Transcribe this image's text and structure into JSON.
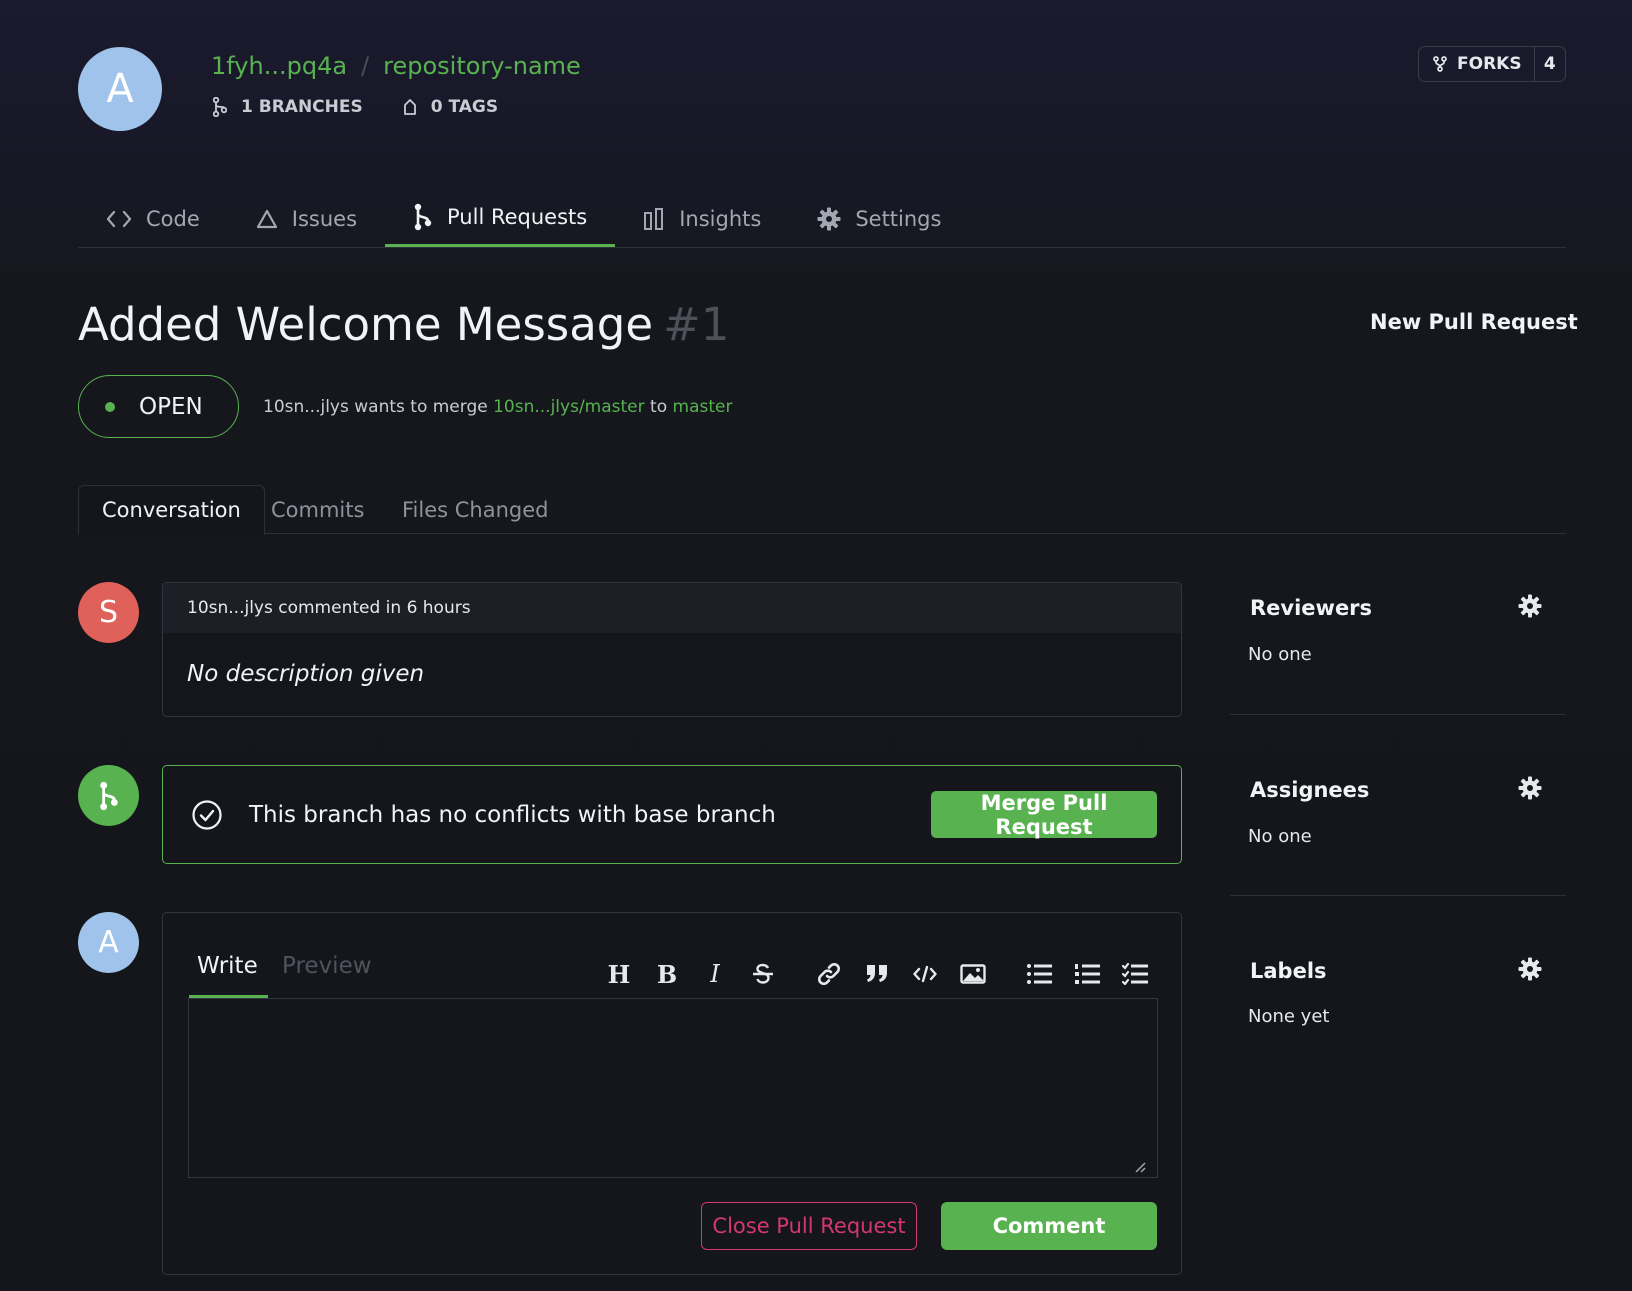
{
  "repo": {
    "avatar_letter": "A",
    "owner": "1fyh...pq4a",
    "separator": "/",
    "name": "repository-name",
    "branches": "1 BRANCHES",
    "tags": "0 TAGS",
    "forks_label": "FORKS",
    "forks_count": "4"
  },
  "nav": {
    "tabs": [
      {
        "label": "Code",
        "icon": "code-icon"
      },
      {
        "label": "Issues",
        "icon": "warning-triangle-icon"
      },
      {
        "label": "Pull Requests",
        "icon": "pull-request-icon",
        "active": true
      },
      {
        "label": "Insights",
        "icon": "bar-chart-icon"
      },
      {
        "label": "Settings",
        "icon": "gear-icon"
      }
    ]
  },
  "pr": {
    "title": "Added Welcome Message",
    "number": "#1",
    "new_button": "New Pull Request",
    "status": "OPEN",
    "author": "10sn...jlys",
    "wants_to_merge": "wants to merge",
    "source_branch": "10sn...jlys/master",
    "to": "to",
    "target_branch": "master"
  },
  "subtabs": [
    "Conversation",
    "Commits",
    "Files Changed"
  ],
  "timeline": {
    "comment_avatar_letter": "S",
    "comment_header": "10sn...jlys commented in 6 hours",
    "comment_body": "No description given",
    "merge_status": "This branch has no conflicts with base branch",
    "merge_button": "Merge Pull Request",
    "editor_avatar_letter": "A"
  },
  "editor": {
    "write_tab": "Write",
    "preview_tab": "Preview",
    "textarea_value": "",
    "close_button": "Close Pull Request",
    "comment_button": "Comment",
    "toolbar": [
      "H",
      "B",
      "I",
      "strikethrough-icon",
      "link-icon",
      "quote-icon",
      "code-icon",
      "image-icon",
      "bullet-list-icon",
      "numbered-list-icon",
      "task-list-icon"
    ]
  },
  "sidebar": {
    "reviewers_title": "Reviewers",
    "reviewers_value": "No one",
    "assignees_title": "Assignees",
    "assignees_value": "No one",
    "labels_title": "Labels",
    "labels_value": "None yet"
  },
  "colors": {
    "accent_green": "#57b24f",
    "danger_pink": "#d4376f",
    "avatar_blue": "#9fc3ea",
    "avatar_red": "#e0605a"
  }
}
